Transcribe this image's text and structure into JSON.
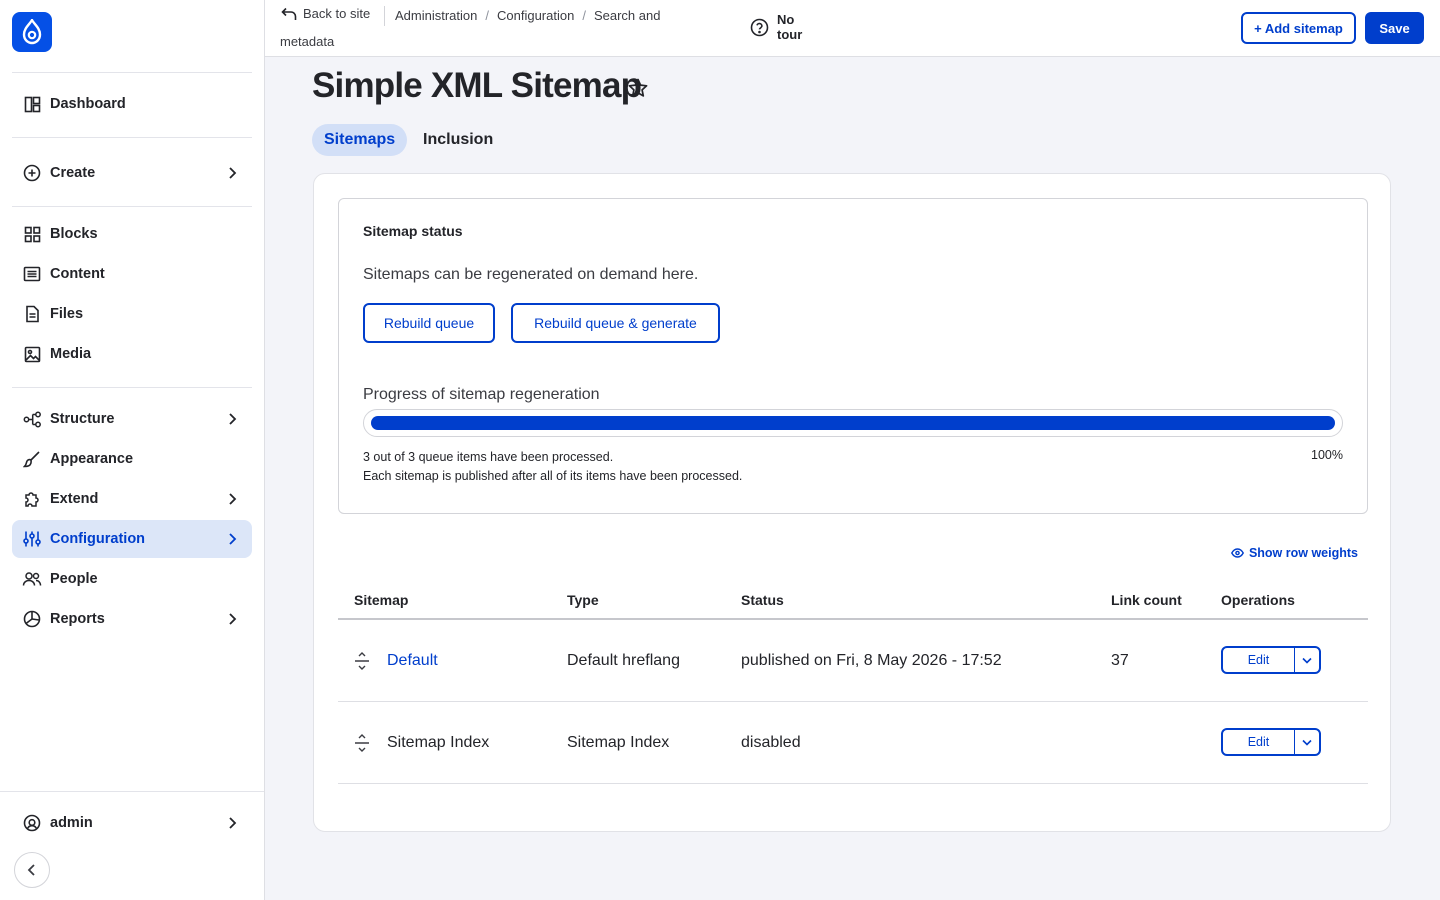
{
  "sidebar": {
    "items": [
      {
        "label": "Dashboard"
      },
      {
        "label": "Create"
      },
      {
        "label": "Blocks"
      },
      {
        "label": "Content"
      },
      {
        "label": "Files"
      },
      {
        "label": "Media"
      },
      {
        "label": "Structure"
      },
      {
        "label": "Appearance"
      },
      {
        "label": "Extend"
      },
      {
        "label": "Configuration"
      },
      {
        "label": "People"
      },
      {
        "label": "Reports"
      }
    ],
    "user": "admin"
  },
  "topbar": {
    "back_label": "Back to site",
    "breadcrumbs": [
      "Administration",
      "Configuration",
      "Search and"
    ],
    "breadcrumb_wrap": "metadata",
    "tour_line1": "No",
    "tour_line2": "tour",
    "add_sitemap": "+ Add sitemap",
    "save": "Save"
  },
  "page": {
    "title": "Simple XML Sitemap",
    "tabs": [
      {
        "label": "Sitemaps",
        "active": true
      },
      {
        "label": "Inclusion",
        "active": false
      }
    ]
  },
  "status": {
    "title": "Sitemap status",
    "description": "Sitemaps can be regenerated on demand here.",
    "rebuild": "Rebuild queue",
    "rebuild_generate": "Rebuild queue & generate",
    "progress_label": "Progress of sitemap regeneration",
    "progress_fraction": 1.0,
    "progress_msg1": "3 out of 3 queue items have been processed.",
    "progress_msg2": "Each sitemap is published after all of its items have been processed.",
    "progress_pct": "100%"
  },
  "table": {
    "show_weights": "Show row weights",
    "headers": [
      "Sitemap",
      "Type",
      "Status",
      "Link count",
      "Operations"
    ],
    "rows": [
      {
        "name": "Default",
        "type": "Default hreflang",
        "status": "published on Fri, 8 May 2026 - 17:52",
        "links": "37",
        "op": "Edit"
      },
      {
        "name": "Sitemap Index",
        "type": "Sitemap Index",
        "status": "disabled",
        "links": "",
        "op": "Edit"
      }
    ]
  },
  "colors": {
    "accent": "#003ecc",
    "active_nav_bg": "#dce6f8",
    "logo_bg": "#0550e6"
  }
}
